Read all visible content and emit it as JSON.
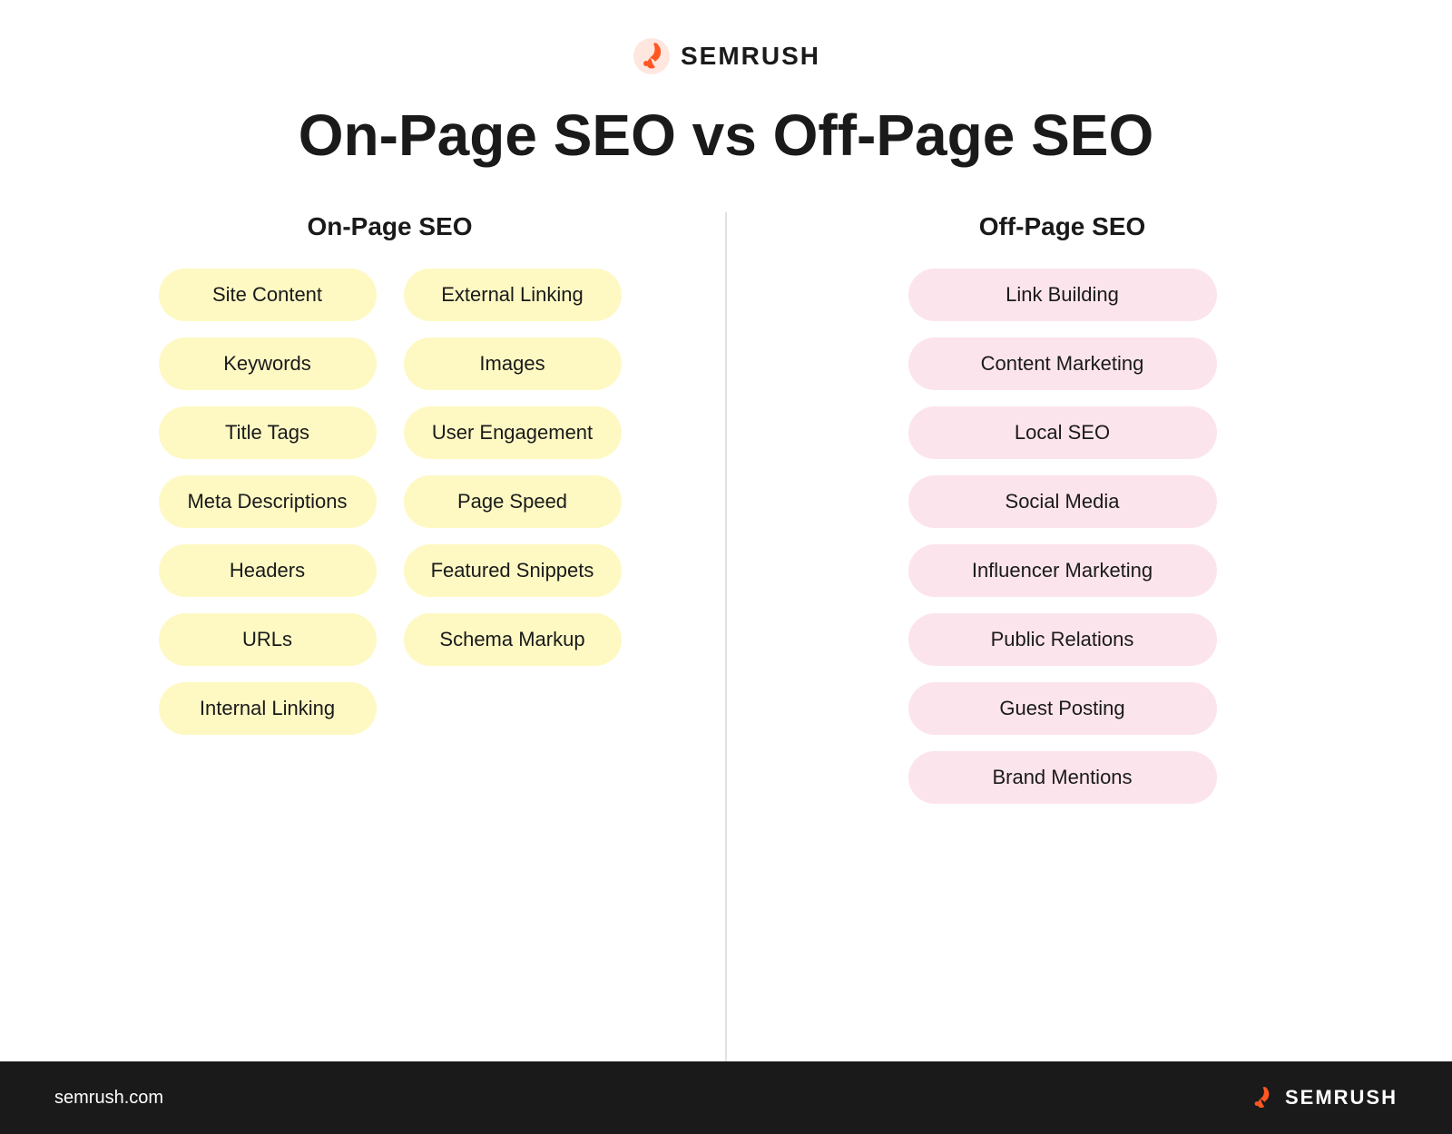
{
  "logo": {
    "text": "SEMRUSH",
    "icon_color": "#ff5722"
  },
  "main_title": "On-Page SEO vs Off-Page SEO",
  "on_page_header": "On-Page SEO",
  "off_page_header": "Off-Page SEO",
  "on_page_col1": [
    "Site Content",
    "Keywords",
    "Title Tags",
    "Meta Descriptions",
    "Headers",
    "URLs",
    "Internal Linking"
  ],
  "on_page_col2": [
    "External Linking",
    "Images",
    "User Engagement",
    "Page Speed",
    "Featured Snippets",
    "Schema Markup"
  ],
  "off_page_items": [
    "Link Building",
    "Content Marketing",
    "Local SEO",
    "Social Media",
    "Influencer Marketing",
    "Public Relations",
    "Guest Posting",
    "Brand Mentions"
  ],
  "footer": {
    "url": "semrush.com",
    "logo_text": "SEMRUSH"
  }
}
